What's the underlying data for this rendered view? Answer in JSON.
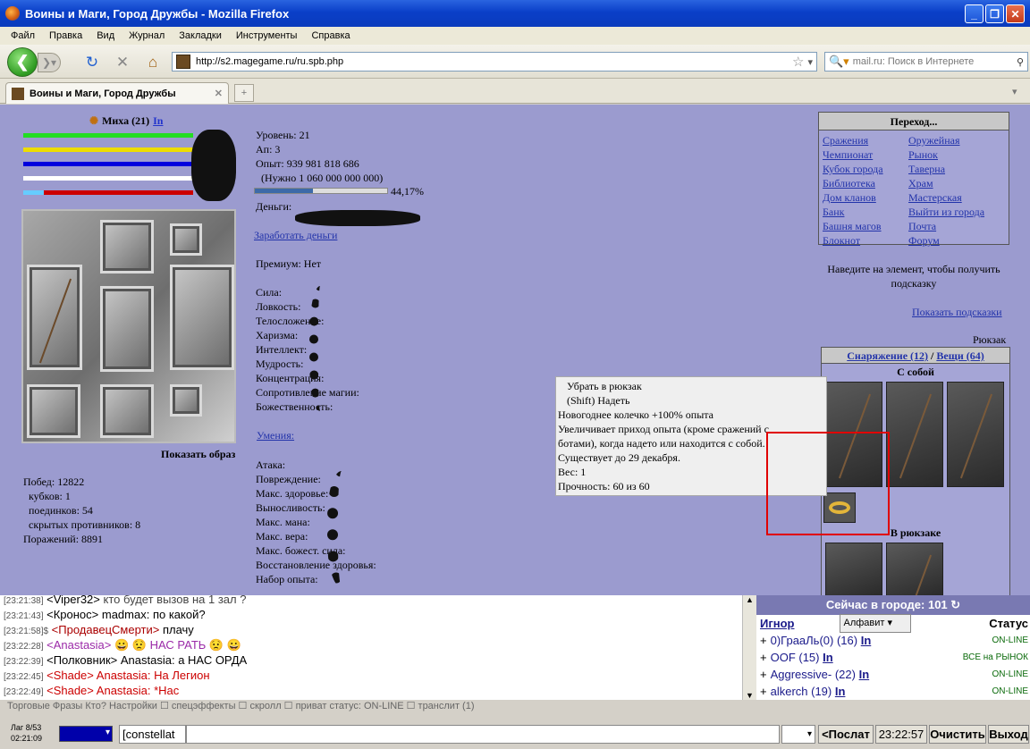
{
  "window": {
    "title": "Воины и Маги, Город Дружбы - Mozilla Firefox"
  },
  "menu": [
    "Файл",
    "Правка",
    "Вид",
    "Журнал",
    "Закладки",
    "Инструменты",
    "Справка"
  ],
  "url": "http://s2.magegame.ru/ru.spb.php",
  "search_placeholder": "mail.ru: Поиск в Интернете",
  "tab": {
    "title": "Воины и Маги, Город Дружбы",
    "new_tab": "+"
  },
  "player": {
    "name": "Миха (21)",
    "info_link": "In"
  },
  "bars": [
    {
      "color": "#22dd22",
      "level": 1.0
    },
    {
      "color": "#eedd00",
      "level": 1.0
    },
    {
      "color": "#0000dd",
      "level": 1.0
    },
    {
      "color": "#ffffff",
      "level": 1.0
    },
    {
      "color": "#cc0000",
      "level": 1.0
    }
  ],
  "stats": {
    "level": "Уровень: 21",
    "ap": "Ап: 3",
    "exp": "Опыт: 939 981 818 686",
    "need": "(Нужно 1 060 000 000 000)",
    "exp_percent": "44,17%",
    "exp_fraction": 0.4417,
    "money": "Деньги:",
    "earn_link": "Заработать деньги",
    "premium": "Премиум: Нет",
    "attrs": [
      "Сила:",
      "Ловкость:",
      "Телосложение:",
      "Харизма:",
      "Интеллект:",
      "Мудрость:",
      "Концентрация:",
      "Сопротивление магии:",
      "Божественность:"
    ],
    "skills_link": "Умения:",
    "combat": [
      "Атака:",
      "Повреждение:",
      "Макс. здоровье:",
      "Выносливость:",
      "Макс. мана:",
      "Макс. вера:",
      "Макс. божест. сила:",
      "Восстановление здоровья:",
      "Набор опыта:"
    ]
  },
  "show_image": "Показать образ",
  "record": {
    "wins": "Побед: 12822",
    "cups": "кубков: 1",
    "duels": "поединков: 54",
    "hidden": "скрытых противников: 8",
    "losses": "Поражений: 8891"
  },
  "nav": {
    "header": "Переход...",
    "left": [
      "Сражения",
      "Чемпионат",
      "Кубок города",
      "Библиотека",
      "Дом кланов",
      "Банк",
      "Башня магов",
      "Блокнот"
    ],
    "right": [
      "Оружейная",
      "Рынок",
      "Таверна",
      "Храм",
      "Мастерская",
      "Выйти из города",
      "Почта",
      "Форум"
    ]
  },
  "hint": {
    "text": "Наведите на элемент, чтобы получить подсказку",
    "show_link": "Показать подсказки"
  },
  "backpack": {
    "label": "Рюкзак",
    "equip_link": "Снаряжение (12)",
    "sep": "/",
    "items_link": "Вещи (64)",
    "with_me": "С собой",
    "in_backpack": "В рюкзаке"
  },
  "tooltip": [
    "Убрать в рюкзак",
    "(Shift) Надеть",
    "Новогоднее колечко +100% опыта",
    "Увеличивает приход опыта (кроме сражений с",
    "ботами), когда надето или находится с собой.",
    "Существует до 29 декабря.",
    "Вес: 1",
    "Прочность: 60 из 60"
  ],
  "chat": [
    {
      "time": "[23:21:38]",
      "who": "<Viper32>",
      "msg": "кто будет вызов на 1 зал ?",
      "color": "#000000"
    },
    {
      "time": "[23:21:43]",
      "who": "<Кронос>",
      "msg": "madmax: по какой?",
      "color": "#000000"
    },
    {
      "time": "[23:21:58]$",
      "who": "<ПродавецСмерти>",
      "msg": "плачу",
      "color": "#aa0000"
    },
    {
      "time": "[23:22:28]",
      "who": "<Anastasia>",
      "msg": "😀 😟 НАС РАТЬ 😟 😀",
      "color": "#9b2aa8"
    },
    {
      "time": "[23:22:39]",
      "who": "<Полковник>",
      "msg": "Anastasia: а НАС ОРДА",
      "color": "#000000"
    },
    {
      "time": "[23:22:45]",
      "who": "<Shade>",
      "msg": "Anastasia: На Легион",
      "color": "#cc0000"
    },
    {
      "time": "[23:22:49]",
      "who": "<Shade>",
      "msg": "Anastasia: *Нас",
      "color": "#cc0000"
    }
  ],
  "online": {
    "header": "Сейчас в городе: 101",
    "ignore": "Игнор",
    "sort": "Алфавит",
    "status_hdr": "Статус",
    "rows": [
      {
        "name": "0)ГрааЛь(0) (16)",
        "link": "In",
        "status": "ON-LINE"
      },
      {
        "name": "OOF (15)",
        "link": "In",
        "status": "ВСЕ на РЫНОК"
      },
      {
        "name": "Aggressive- (22)",
        "link": "In",
        "status": "ON-LINE"
      },
      {
        "name": "alkerch (19)",
        "link": "In",
        "status": "ON-LINE"
      }
    ]
  },
  "bottom": {
    "options": "Торговые Фразы Кто? Настройки ☐ спецэффекты ☐ скролл ☐ приват статус: ON-LINE ☐ транслит (1)",
    "lag": "Лаг 8/53",
    "time": "02:21:09",
    "input_prefix": "[constellat",
    "send": "<Послат",
    "clock": "23:22:57",
    "clear": "Очистить",
    "exit": "Выход"
  }
}
